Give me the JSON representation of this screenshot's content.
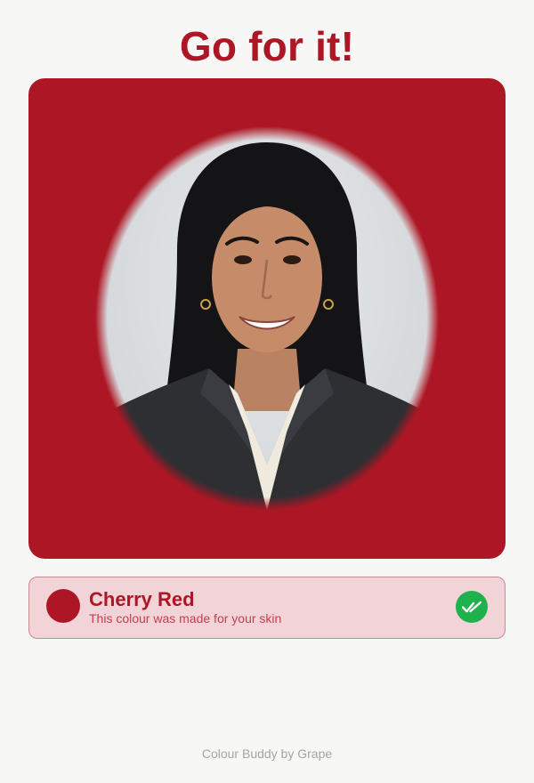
{
  "header": {
    "headline": "Go for it!"
  },
  "preview": {
    "background_color": "#ad1725",
    "photo": "portrait-photo"
  },
  "result": {
    "color_name": "Cherry Red",
    "color_hex": "#ad1725",
    "description": "This colour was made for your skin",
    "status_icon": "double-check-icon",
    "status_color": "#1fb14b"
  },
  "footer": {
    "credit": "Colour Buddy by Grape"
  }
}
